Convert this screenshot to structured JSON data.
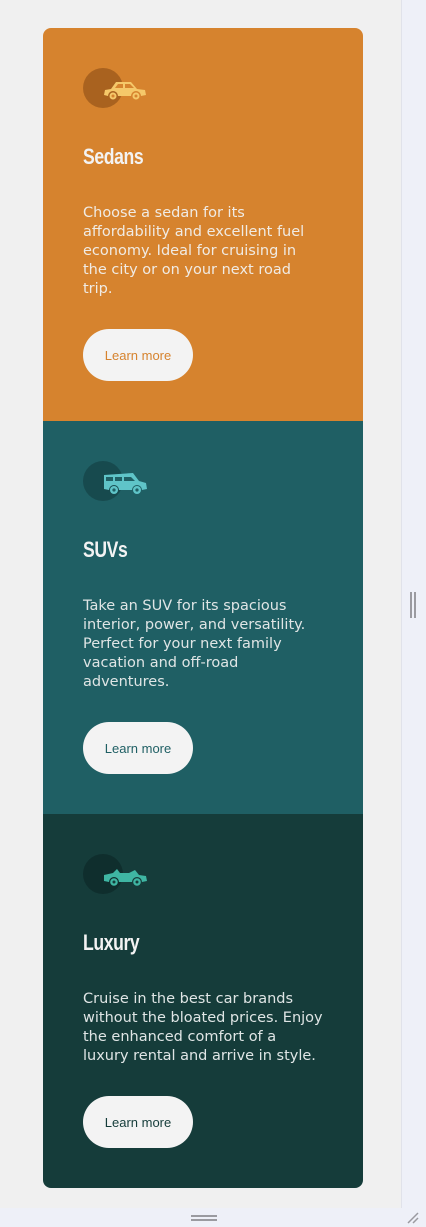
{
  "cards": [
    {
      "title": "Sedans",
      "icon": "sedan-car-icon",
      "description": "Choose a sedan for its affordability and excellent fuel economy. Ideal for cruising in the city or on your next road trip.",
      "button": "Learn more",
      "color": "#d6832e"
    },
    {
      "title": "SUVs",
      "icon": "suv-car-icon",
      "description": "Take an SUV for its spacious interior, power, and versatility. Perfect for your next family vacation and off-road adventures.",
      "button": "Learn more",
      "color": "#1f5f64"
    },
    {
      "title": "Luxury",
      "icon": "convertible-car-icon",
      "description": "Cruise in the best car brands without the bloated prices. Enjoy the enhanced comfort of a luxury rental and arrive in style.",
      "button": "Learn more",
      "color": "#153c3a"
    }
  ],
  "colors": {
    "page_background": "#f0f0f0",
    "text_light": "#f3f3f3"
  }
}
